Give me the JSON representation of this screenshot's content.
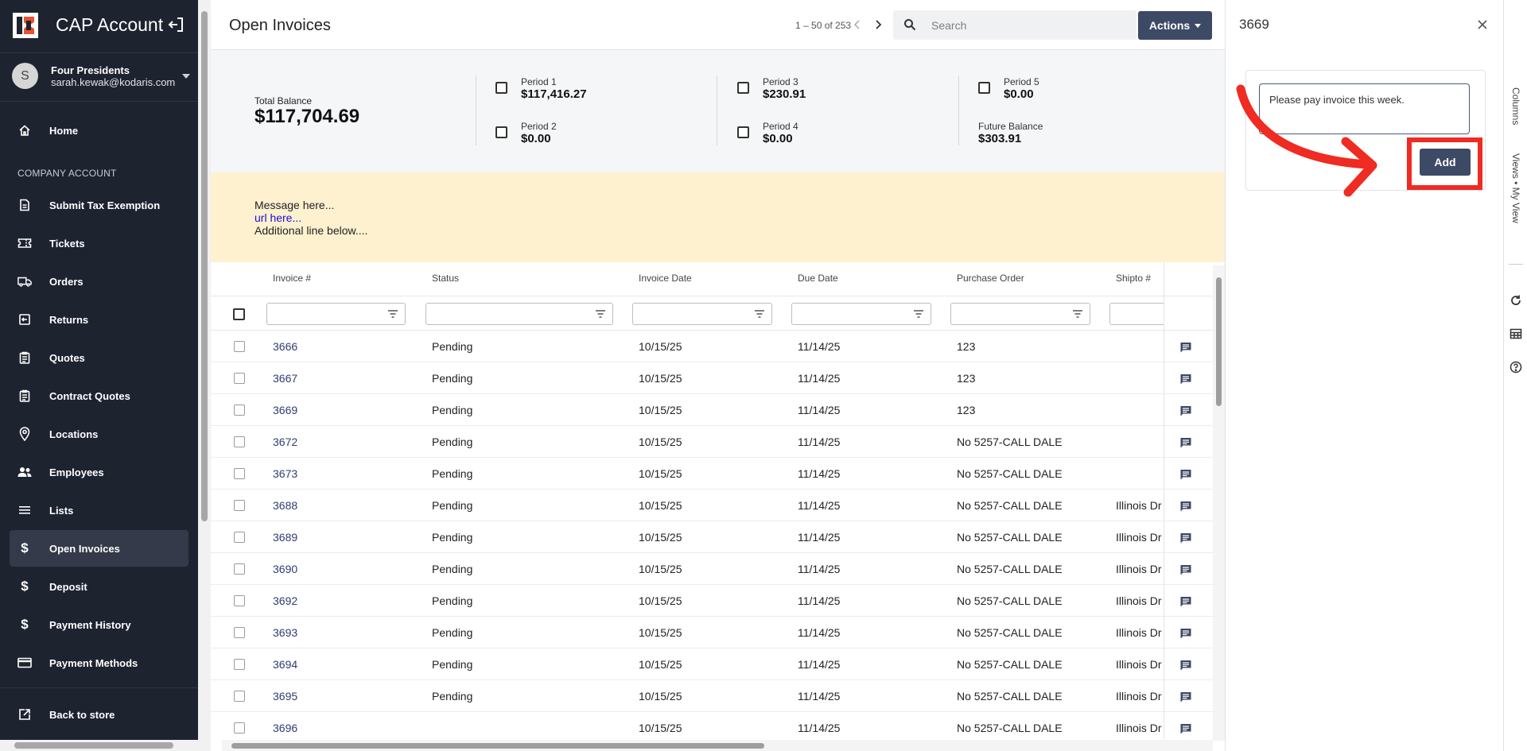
{
  "sidebar": {
    "app_title": "CAP Account",
    "user": {
      "initial": "S",
      "company": "Four Presidents",
      "email": "sarah.kewak@kodaris.com"
    },
    "section_label": "COMPANY ACCOUNT",
    "items": [
      {
        "label": "Home",
        "icon": "home-icon"
      },
      {
        "label": "Submit Tax Exemption",
        "icon": "document-icon"
      },
      {
        "label": "Tickets",
        "icon": "ticket-icon"
      },
      {
        "label": "Orders",
        "icon": "truck-icon"
      },
      {
        "label": "Returns",
        "icon": "return-icon"
      },
      {
        "label": "Quotes",
        "icon": "clipboard-icon"
      },
      {
        "label": "Contract Quotes",
        "icon": "clipboard-icon"
      },
      {
        "label": "Locations",
        "icon": "location-pin-icon"
      },
      {
        "label": "Employees",
        "icon": "people-icon"
      },
      {
        "label": "Lists",
        "icon": "list-icon"
      },
      {
        "label": "Open Invoices",
        "icon": "dollar-icon"
      },
      {
        "label": "Deposit",
        "icon": "dollar-icon"
      },
      {
        "label": "Payment History",
        "icon": "dollar-icon"
      },
      {
        "label": "Payment Methods",
        "icon": "credit-card-icon"
      },
      {
        "label": "Back to store",
        "icon": "external-link-icon"
      }
    ],
    "active_item": "Open Invoices"
  },
  "header": {
    "title": "Open Invoices",
    "pager": "1 – 50 of 253",
    "search_placeholder": "Search",
    "actions_label": "Actions"
  },
  "balance": {
    "total_label": "Total Balance",
    "total_value": "$117,704.69",
    "periods": [
      {
        "label": "Period 1",
        "value": "$117,416.27"
      },
      {
        "label": "Period 2",
        "value": "$0.00"
      },
      {
        "label": "Period 3",
        "value": "$230.91"
      },
      {
        "label": "Period 4",
        "value": "$0.00"
      },
      {
        "label": "Period 5",
        "value": "$0.00"
      }
    ],
    "future_label": "Future Balance",
    "future_value": "$303.91"
  },
  "message": {
    "line1": "Message here...",
    "link": "url here...",
    "line3": "Additional line below...."
  },
  "table": {
    "columns": [
      "Invoice #",
      "Status",
      "Invoice Date",
      "Due Date",
      "Purchase Order",
      "Shipto #"
    ],
    "rows": [
      {
        "invoice": "3666",
        "status": "Pending",
        "invoice_date": "10/15/25",
        "due_date": "11/14/25",
        "po": "123",
        "shipto": ""
      },
      {
        "invoice": "3667",
        "status": "Pending",
        "invoice_date": "10/15/25",
        "due_date": "11/14/25",
        "po": "123",
        "shipto": ""
      },
      {
        "invoice": "3669",
        "status": "Pending",
        "invoice_date": "10/15/25",
        "due_date": "11/14/25",
        "po": "123",
        "shipto": ""
      },
      {
        "invoice": "3672",
        "status": "Pending",
        "invoice_date": "10/15/25",
        "due_date": "11/14/25",
        "po": "No 5257-CALL DALE",
        "shipto": ""
      },
      {
        "invoice": "3673",
        "status": "Pending",
        "invoice_date": "10/15/25",
        "due_date": "11/14/25",
        "po": "No 5257-CALL DALE",
        "shipto": ""
      },
      {
        "invoice": "3688",
        "status": "Pending",
        "invoice_date": "10/15/25",
        "due_date": "11/14/25",
        "po": "No 5257-CALL DALE",
        "shipto": "Illinois Dr"
      },
      {
        "invoice": "3689",
        "status": "Pending",
        "invoice_date": "10/15/25",
        "due_date": "11/14/25",
        "po": "No 5257-CALL DALE",
        "shipto": "Illinois Dr"
      },
      {
        "invoice": "3690",
        "status": "Pending",
        "invoice_date": "10/15/25",
        "due_date": "11/14/25",
        "po": "No 5257-CALL DALE",
        "shipto": "Illinois Dr"
      },
      {
        "invoice": "3692",
        "status": "Pending",
        "invoice_date": "10/15/25",
        "due_date": "11/14/25",
        "po": "No 5257-CALL DALE",
        "shipto": "Illinois Dr"
      },
      {
        "invoice": "3693",
        "status": "Pending",
        "invoice_date": "10/15/25",
        "due_date": "11/14/25",
        "po": "No 5257-CALL DALE",
        "shipto": "Illinois Dr"
      },
      {
        "invoice": "3694",
        "status": "Pending",
        "invoice_date": "10/15/25",
        "due_date": "11/14/25",
        "po": "No 5257-CALL DALE",
        "shipto": "Illinois Dr"
      },
      {
        "invoice": "3695",
        "status": "Pending",
        "invoice_date": "10/15/25",
        "due_date": "11/14/25",
        "po": "No 5257-CALL DALE",
        "shipto": "Illinois Dr"
      },
      {
        "invoice": "3696",
        "status": "",
        "invoice_date": "10/15/25",
        "due_date": "11/14/25",
        "po": "No 5257-CALL DALE",
        "shipto": "Illinois Dr"
      }
    ]
  },
  "panel": {
    "title": "3669",
    "note_text": "Please pay invoice this week.",
    "add_label": "Add"
  },
  "rail": {
    "columns_label": "Columns",
    "views_label": "Views • My View"
  },
  "colors": {
    "sidebar_bg": "#1e2330",
    "accent": "#3d4a66",
    "message_bg": "#fdf1cf",
    "highlight": "#ef2b22"
  }
}
